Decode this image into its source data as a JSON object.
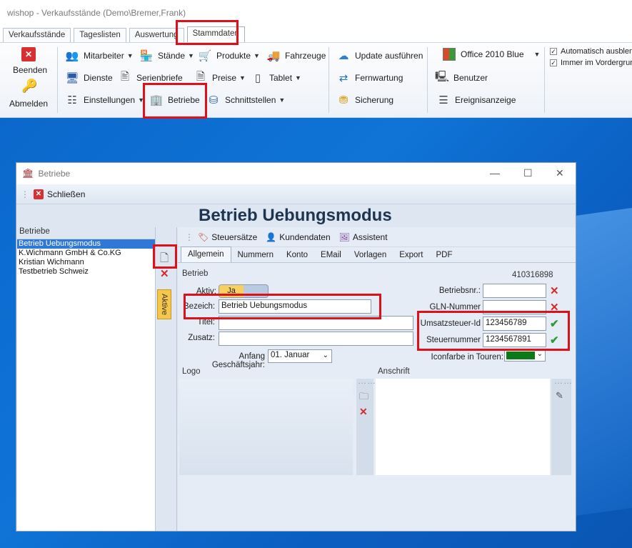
{
  "app": {
    "title": "wishop - Verkaufsstände (Demo\\Bremer,Frank)",
    "tabs": [
      "Verkaufsstände",
      "Tageslisten",
      "Auswertung",
      "Stammdaten"
    ]
  },
  "ribbon": {
    "beenden": "Beenden",
    "abmelden": "Abmelden",
    "mitarbeiter": "Mitarbeiter",
    "staende": "Stände",
    "produkte": "Produkte",
    "fahrzeuge": "Fahrzeuge",
    "dienste": "Dienste",
    "serienbriefe": "Serienbriefe",
    "preise": "Preise",
    "tablet": "Tablet",
    "einstellungen": "Einstellungen",
    "betriebe": "Betriebe",
    "schnittstellen": "Schnittstellen",
    "update": "Update ausführen",
    "fernwartung": "Fernwartung",
    "sicherung": "Sicherung",
    "theme": "Office 2010 Blue",
    "benutzer": "Benutzer",
    "ereignisanzeige": "Ereignisanzeige",
    "auto_hide": "Automatisch ausblend",
    "always_front": "Immer im Vordergrund"
  },
  "dialog": {
    "title": "Betriebe",
    "close_button": "Schließen",
    "heading": "Betrieb Uebungsmodus",
    "list_header": "Betriebe",
    "list_items": [
      "Betrieb Uebungsmodus",
      "K.Wichmann GmbH & Co.KG",
      "Kristian Wichmann",
      "Testbetrieb Schweiz"
    ],
    "aktive_label": "Aktive",
    "subtoolbar": {
      "steuersaetze": "Steuersätze",
      "kundendaten": "Kundendaten",
      "assistent": "Assistent"
    },
    "tabs": [
      "Allgemein",
      "Nummern",
      "Konto",
      "EMail",
      "Vorlagen",
      "Export",
      "PDF"
    ],
    "section_label": "Betrieb",
    "id_number": "410316898",
    "form": {
      "aktiv_label": "Aktiv:",
      "aktiv_value": "Ja",
      "bezeich_label": "Bezeich:",
      "bezeich_value": "Betrieb Uebungsmodus",
      "titel_label": "Titel:",
      "zusatz_label": "Zusatz:",
      "anfang_label": "Anfang Geschäftsjahr:",
      "anfang_value": "01.  Januar",
      "betriebsnr_label": "Betriebsnr.:",
      "gln_label": "GLN-Nummer",
      "ust_label": "Umsatzsteuer-Id",
      "ust_value": "123456789",
      "steuer_label": "Steuernummer",
      "steuer_value": "1234567891",
      "iconfarbe_label": "Iconfarbe in Touren:",
      "iconfarbe_color": "#0a7a16"
    },
    "logo_label": "Logo",
    "anschrift_label": "Anschrift"
  }
}
